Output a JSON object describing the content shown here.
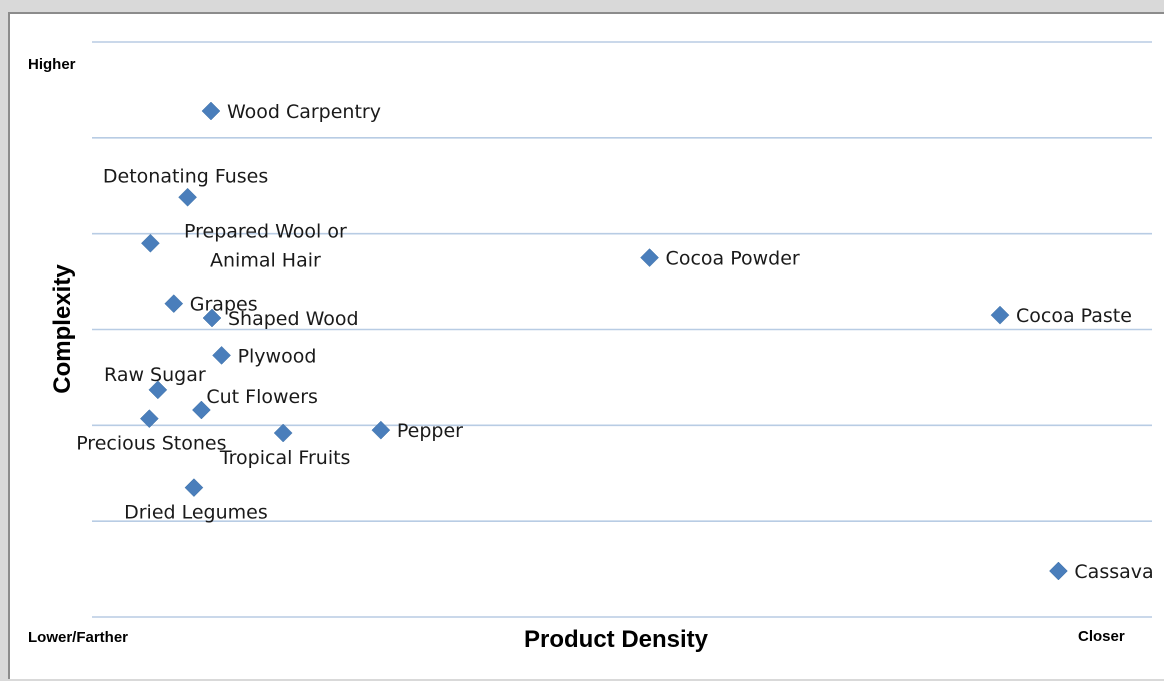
{
  "chart_data": {
    "type": "scatter",
    "title": "",
    "xlabel": "Product Density",
    "ylabel": "Complexity",
    "x_low_label": "Lower/Farther",
    "x_high_label": "Closer",
    "y_high_label": "Higher",
    "xlim": [
      0,
      100
    ],
    "ylim": [
      0,
      100
    ],
    "grid": true,
    "legend": "none",
    "marker": "diamond",
    "marker_color": "#4a7ebb",
    "grid_color": "#b8cce4",
    "points": [
      {
        "label": "Wood Carpentry",
        "x": 11.2,
        "y": 88.0,
        "label_pos": "right"
      },
      {
        "label": "Detonating Fuses",
        "x": 9.0,
        "y": 73.0,
        "label_pos": "above"
      },
      {
        "label": "Prepared Wool or Animal Hair",
        "x": 5.5,
        "y": 65.0,
        "label_pos": "right-two-line"
      },
      {
        "label": "Cocoa Powder",
        "x": 52.5,
        "y": 62.5,
        "label_pos": "right"
      },
      {
        "label": "Grapes",
        "x": 7.7,
        "y": 54.5,
        "label_pos": "right"
      },
      {
        "label": "Shaped Wood",
        "x": 11.3,
        "y": 52.0,
        "label_pos": "right"
      },
      {
        "label": "Cocoa Paste",
        "x": 85.5,
        "y": 52.5,
        "label_pos": "right"
      },
      {
        "label": "Plywood",
        "x": 12.2,
        "y": 45.5,
        "label_pos": "right"
      },
      {
        "label": "Raw Sugar",
        "x": 6.2,
        "y": 39.5,
        "label_pos": "above-left"
      },
      {
        "label": "Cut Flowers",
        "x": 10.3,
        "y": 36.0,
        "label_pos": "above-right"
      },
      {
        "label": "Precious Stones",
        "x": 5.4,
        "y": 34.5,
        "label_pos": "below"
      },
      {
        "label": "Tropical Fruits",
        "x": 18.0,
        "y": 32.0,
        "label_pos": "below"
      },
      {
        "label": "Pepper",
        "x": 27.2,
        "y": 32.5,
        "label_pos": "right"
      },
      {
        "label": "Dried Legumes",
        "x": 9.6,
        "y": 22.5,
        "label_pos": "below"
      },
      {
        "label": "Cassava",
        "x": 91.0,
        "y": 8.0,
        "label_pos": "right"
      }
    ]
  }
}
